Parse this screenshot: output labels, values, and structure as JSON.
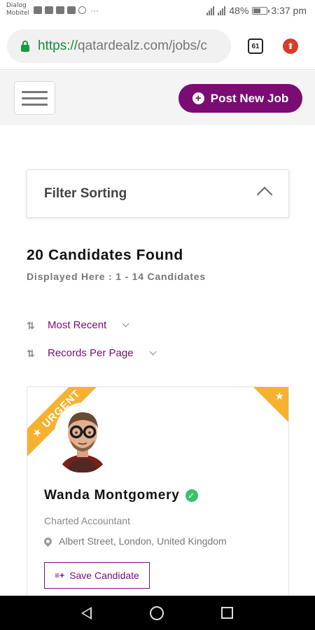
{
  "status_bar": {
    "carrier_line1": "Dialog",
    "carrier_line2": "Mobitel",
    "dots": "···",
    "battery_percent": "48%",
    "time": "3:37 pm"
  },
  "browser": {
    "url_secure": "https://",
    "url_host": "qatardealz.com",
    "url_path": "/jobs/c",
    "tab_count": "61"
  },
  "header": {
    "post_job_label": "Post New Job"
  },
  "filter": {
    "title": "Filter Sorting"
  },
  "results": {
    "count_title": "20 Candidates Found",
    "count_sub": "Displayed Here : 1 - 14 Candidates"
  },
  "sort": {
    "order_label": "Most Recent",
    "per_page_label": "Records Per Page"
  },
  "candidate": {
    "ribbon": "URGENT",
    "name": "Wanda Montgomery",
    "role": "Charted Accountant",
    "location": "Albert Street, London, United Kingdom",
    "save_label": "Save Candidate"
  },
  "colors": {
    "brand_purple": "#7a0c74",
    "ribbon_orange": "#f6b12f",
    "verified_green": "#35c46a",
    "secure_green": "#1a8a3a"
  },
  "icons": {
    "hamburger": "menu-icon",
    "post": "plus-circle-icon",
    "filter": "chevron-up-icon",
    "sort": "sort-arrows-icon",
    "verified": "check-badge-icon",
    "location": "map-pin-icon",
    "save": "bookmark-list-icon"
  }
}
